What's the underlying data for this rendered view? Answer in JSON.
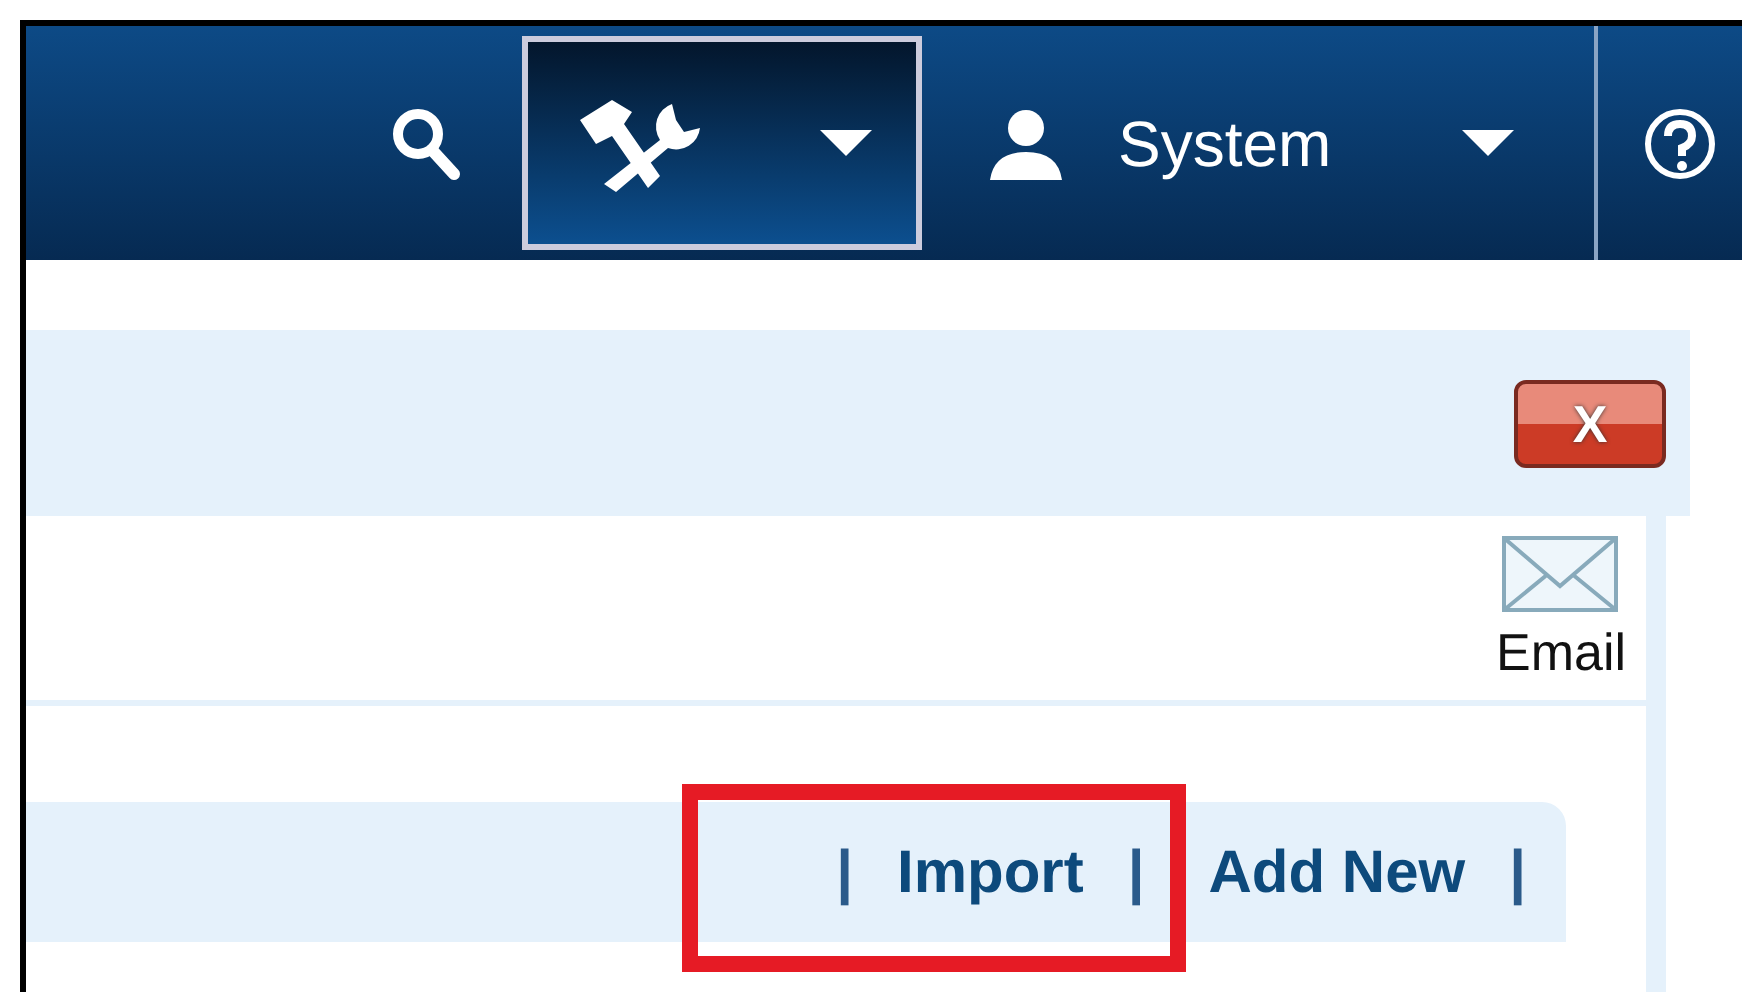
{
  "navbar": {
    "items": [
      {
        "kind": "search",
        "selected": false
      },
      {
        "kind": "tools",
        "selected": true
      },
      {
        "kind": "user",
        "label": "System",
        "selected": false
      },
      {
        "kind": "help",
        "selected": false
      }
    ]
  },
  "panel": {
    "close_label": "X",
    "email_label": "Email"
  },
  "toolbar": {
    "items": [
      {
        "kind": "separator",
        "text": "|"
      },
      {
        "kind": "link",
        "text": "Import",
        "highlighted": true
      },
      {
        "kind": "separator",
        "text": "|"
      },
      {
        "kind": "link",
        "text": "Add New",
        "highlighted": false
      },
      {
        "kind": "separator",
        "text": "|"
      }
    ]
  }
}
